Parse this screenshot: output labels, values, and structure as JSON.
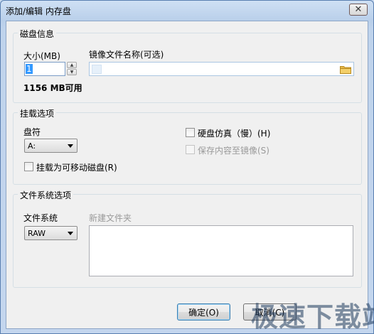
{
  "window": {
    "title": "添加/编辑 内存盘",
    "close_glyph": "✕"
  },
  "disk_info": {
    "group_title": "磁盘信息",
    "size_label": "大小(MB)",
    "size_value": "1",
    "available_text": "1156 MB可用",
    "image_name_label": "镜像文件名称(可选)",
    "image_name_value": ""
  },
  "mount_options": {
    "group_title": "挂载选项",
    "drive_letter_label": "盘符",
    "drive_letter_value": "A:",
    "removable_label": "挂载为可移动磁盘(R)",
    "removable_checked": false,
    "hard_disk_emulation_label": "硬盘仿真（慢）(H)",
    "hard_disk_emulation_checked": false,
    "save_to_image_label": "保存内容至镜像(S)",
    "save_to_image_checked": false,
    "save_to_image_enabled": false
  },
  "fs_options": {
    "group_title": "文件系统选项",
    "fs_label": "文件系统",
    "fs_value": "RAW",
    "new_folder_label": "新建文件夹"
  },
  "buttons": {
    "ok": "确定(O)",
    "cancel": "取消(C)"
  },
  "watermark": "极速下载站",
  "icons": {
    "close": "close-icon",
    "folder": "folder-icon",
    "spin_up": "spin-up-icon",
    "spin_down": "spin-down-icon"
  }
}
